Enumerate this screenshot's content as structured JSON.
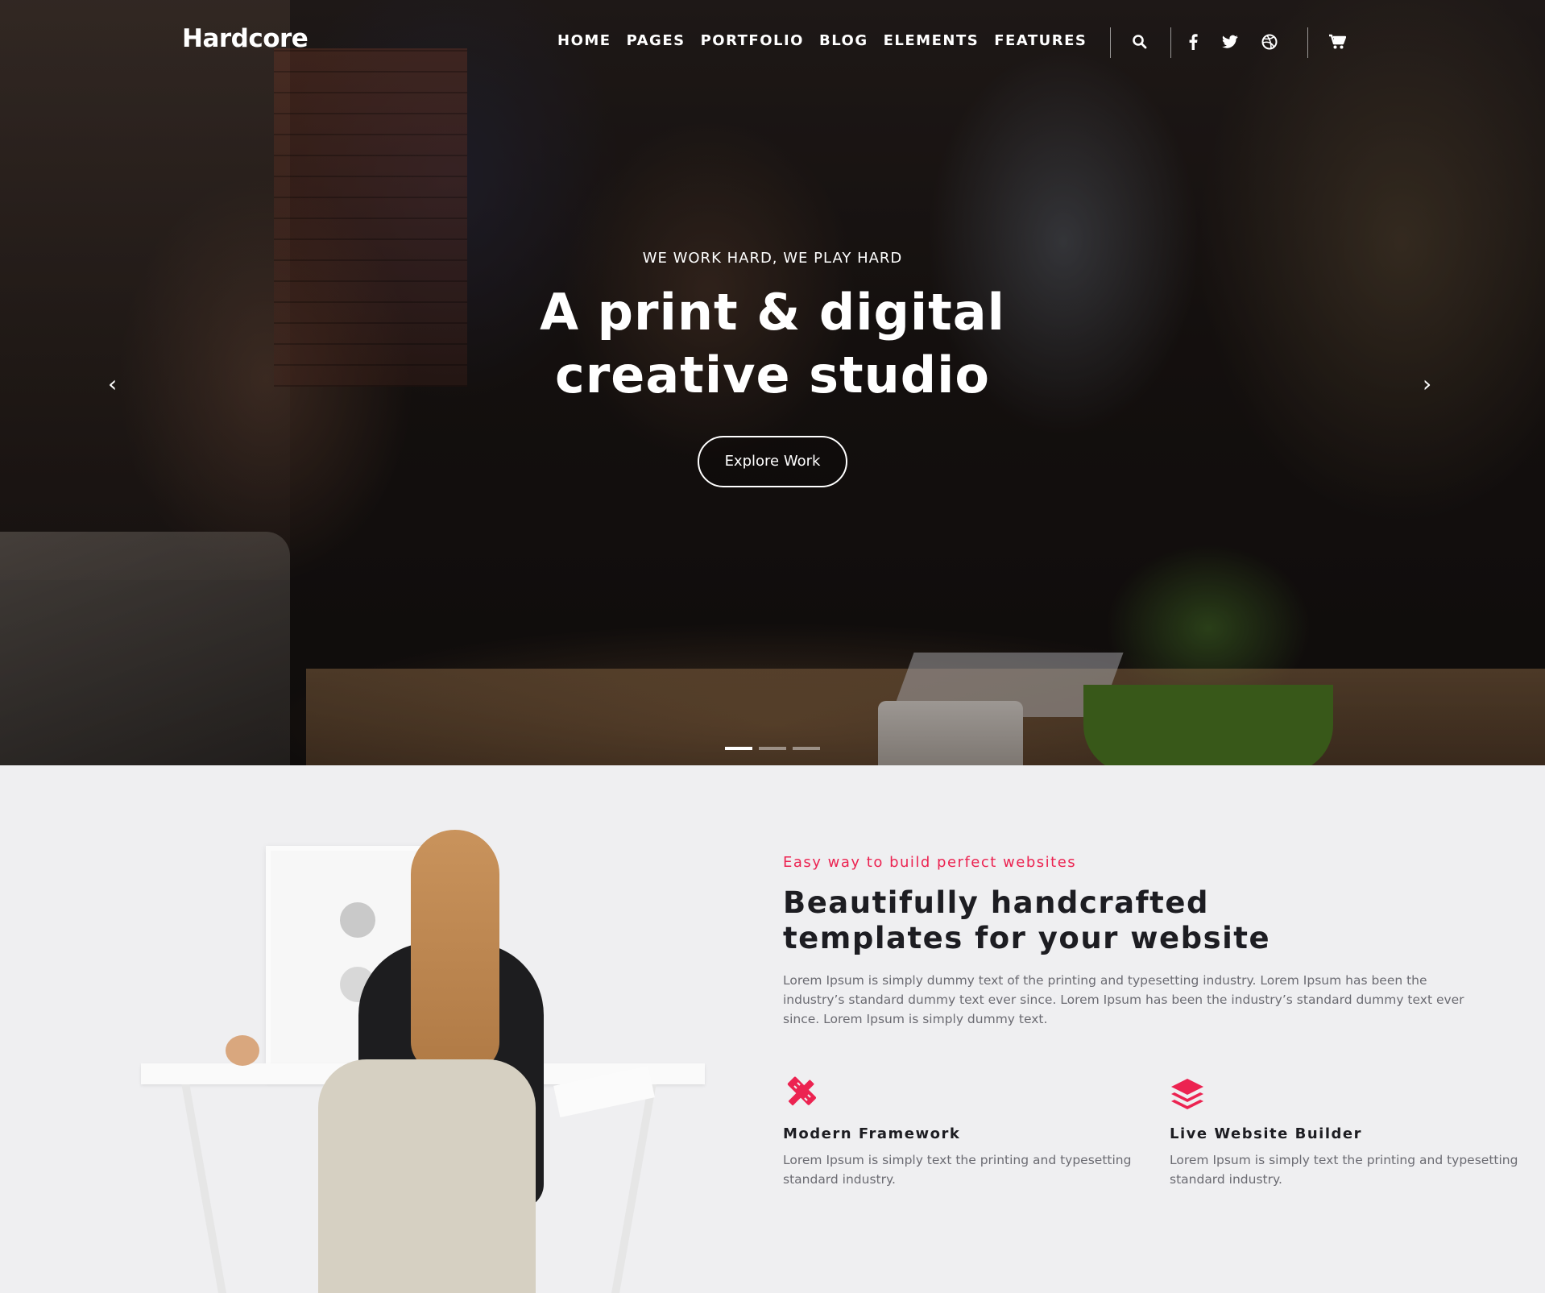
{
  "header": {
    "brand": "Hardcore",
    "nav": [
      "HOME",
      "PAGES",
      "PORTFOLIO",
      "BLOG",
      "ELEMENTS",
      "FEATURES"
    ],
    "icons": [
      "search-icon",
      "facebook-icon",
      "twitter-icon",
      "dribbble-icon",
      "cart-icon"
    ]
  },
  "hero": {
    "eyebrow": "WE WORK HARD, WE PLAY HARD",
    "title_line1": "A print & digital",
    "title_line2": "creative studio",
    "button": "Explore Work",
    "slides": 3,
    "active_slide": 1
  },
  "about": {
    "eyebrow": "Easy way to build perfect websites",
    "title_line1": "Beautifully handcrafted",
    "title_line2": "templates for your website",
    "description": "Lorem Ipsum is simply dummy text of the printing and typesetting industry. Lorem Ipsum has been the industry’s standard dummy text ever since. Lorem Ipsum has been the industry’s standard dummy text ever since. Lorem Ipsum is simply dummy text.",
    "features": [
      {
        "icon": "pencil-ruler-icon",
        "title": "Modern Framework",
        "text": "Lorem Ipsum is simply text the printing and typesetting standard industry."
      },
      {
        "icon": "layers-icon",
        "title": "Live Website Builder",
        "text": "Lorem Ipsum is simply text the printing and typesetting standard industry."
      }
    ]
  },
  "colors": {
    "accent": "#ec2351",
    "dark": "#1d1d22",
    "text_muted": "#6b6b72",
    "section_bg": "#efeff1"
  }
}
